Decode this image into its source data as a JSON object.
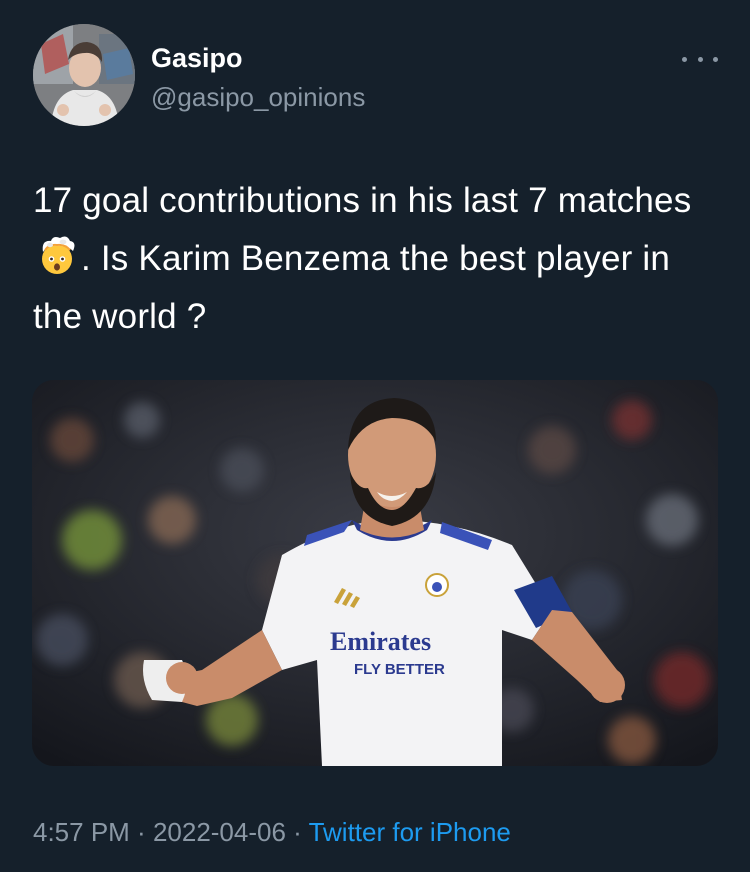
{
  "user": {
    "display_name": "Gasipo",
    "handle": "@gasipo_opinions",
    "avatar_icon": "profile-photo"
  },
  "more_icon": "ellipsis-icon",
  "tweet": {
    "text_part1": "17 goal contributions in his last 7 matches",
    "emoji": "exploding-head-emoji",
    "text_part2": ". Is Karim Benzema the best player in the world ?"
  },
  "media": {
    "kit_sponsor": "Emirates",
    "kit_slogan": "FLY BETTER"
  },
  "footer": {
    "time": "4:57 PM",
    "separator1": " · ",
    "date": "2022-04-06",
    "separator2": " · ",
    "source": "Twitter for iPhone"
  },
  "colors": {
    "background": "#15202b",
    "text_primary": "#ffffff",
    "text_secondary": "#8b98a5",
    "link": "#1d9bf0"
  }
}
